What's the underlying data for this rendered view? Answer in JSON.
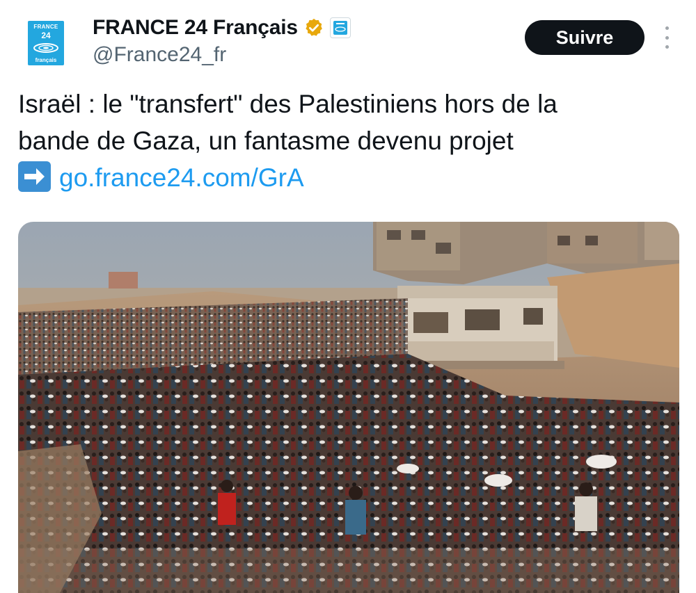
{
  "author": {
    "avatar": {
      "line1": "FRANCE",
      "line2": "24",
      "line3": "français"
    },
    "display_name": "FRANCE 24 Français",
    "handle": "@France24_fr",
    "verified_icon": "gold-check-badge",
    "affiliation_icon": "france24-affiliate-badge"
  },
  "actions": {
    "follow_label": "Suivre",
    "more_icon": "vertical-ellipsis"
  },
  "tweet": {
    "line1": "Israël : le \"transfert\" des Palestiniens hors de la",
    "line2": "bande de Gaza, un fantasme devenu projet",
    "arrow_icon": "right-arrow-emoji",
    "link_text": "go.france24.com/GrA"
  },
  "colors": {
    "link": "#1d9bf0",
    "follow_bg": "#0f1419",
    "verified": "#e8a80c",
    "brand": "#23a7df"
  }
}
